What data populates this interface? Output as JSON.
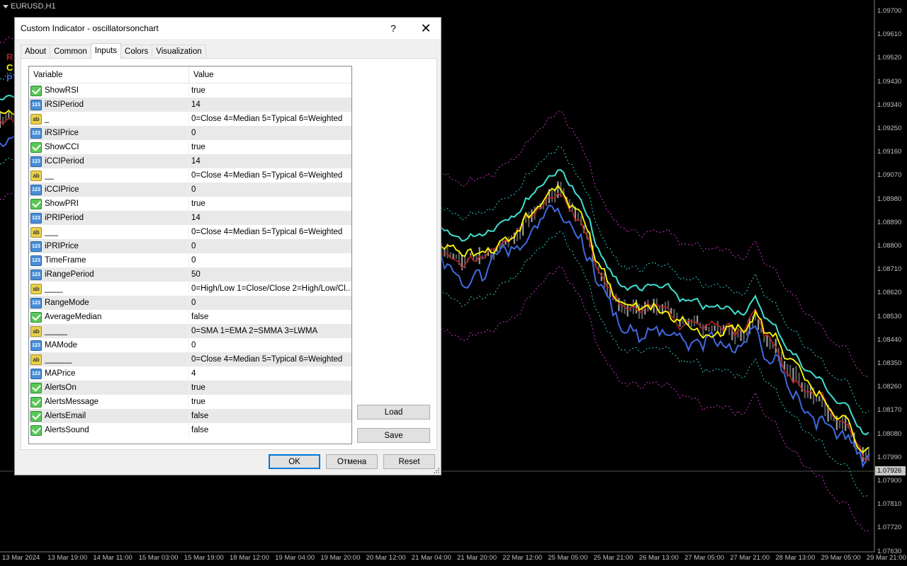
{
  "chart": {
    "symbol": "EURUSD,H1",
    "indicator_letters": [
      {
        "text": "R",
        "color": "#b22222"
      },
      {
        "text": "C",
        "color": "#ffff00"
      },
      {
        "text": "P",
        "color": "#4169e1"
      }
    ],
    "price_axis": [
      "1.09700",
      "1.09610",
      "1.09520",
      "1.09430",
      "1.09340",
      "1.09250",
      "1.09160",
      "1.09070",
      "1.08980",
      "1.08890",
      "1.08800",
      "1.08710",
      "1.08620",
      "1.08530",
      "1.08440",
      "1.08350",
      "1.08260",
      "1.08170",
      "1.08080",
      "1.07990",
      "1.07900",
      "1.07810",
      "1.07720",
      "1.07630"
    ],
    "current_price": "1.07926",
    "time_axis": [
      "13 Mar 2024",
      "13 Mar 19:00",
      "14 Mar 11:00",
      "15 Mar 03:00",
      "15 Mar 19:00",
      "18 Mar 12:00",
      "19 Mar 04:00",
      "19 Mar 20:00",
      "20 Mar 12:00",
      "21 Mar 04:00",
      "21 Mar 20:00",
      "22 Mar 12:00",
      "25 Mar 05:00",
      "25 Mar 21:00",
      "26 Mar 13:00",
      "27 Mar 05:00",
      "27 Mar 21:00",
      "28 Mar 13:00",
      "29 Mar 05:00",
      "29 Mar 21:00"
    ]
  },
  "dialog": {
    "title": "Custom Indicator - oscillatorsonchart",
    "help_glyph": "?",
    "close_glyph": "✕",
    "tabs": [
      "About",
      "Common",
      "Inputs",
      "Colors",
      "Visualization"
    ],
    "active_tab": "Inputs",
    "columns": {
      "variable": "Variable",
      "value": "Value"
    },
    "rows": [
      {
        "type": "bool",
        "variable": "ShowRSI",
        "value": "true"
      },
      {
        "type": "int",
        "variable": "iRSIPeriod",
        "value": "14"
      },
      {
        "type": "str",
        "variable": "_",
        "value": "0=Close 4=Median 5=Typical 6=Weighted"
      },
      {
        "type": "int",
        "variable": "iRSIPrice",
        "value": "0"
      },
      {
        "type": "bool",
        "variable": "ShowCCI",
        "value": "true"
      },
      {
        "type": "int",
        "variable": "iCCIPeriod",
        "value": "14"
      },
      {
        "type": "str",
        "variable": "__",
        "value": "0=Close 4=Median 5=Typical 6=Weighted"
      },
      {
        "type": "int",
        "variable": "iCCIPrice",
        "value": "0"
      },
      {
        "type": "bool",
        "variable": "ShowPRI",
        "value": "true"
      },
      {
        "type": "int",
        "variable": "iPRIPeriod",
        "value": "14"
      },
      {
        "type": "str",
        "variable": "___",
        "value": "0=Close 4=Median 5=Typical 6=Weighted"
      },
      {
        "type": "int",
        "variable": "iPRIPrice",
        "value": "0"
      },
      {
        "type": "int",
        "variable": "TimeFrame",
        "value": "0"
      },
      {
        "type": "int",
        "variable": "iRangePeriod",
        "value": "50"
      },
      {
        "type": "str",
        "variable": "____",
        "value": "0=High/Low 1=Close/Close 2=High/Low/Cl..."
      },
      {
        "type": "int",
        "variable": "RangeMode",
        "value": "0"
      },
      {
        "type": "bool",
        "variable": "AverageMedian",
        "value": "false"
      },
      {
        "type": "str",
        "variable": "_____",
        "value": "0=SMA 1=EMA 2=SMMA 3=LWMA"
      },
      {
        "type": "int",
        "variable": "MAMode",
        "value": "0"
      },
      {
        "type": "str",
        "variable": "______",
        "value": "0=Close 4=Median 5=Typical 6=Weighted"
      },
      {
        "type": "int",
        "variable": "MAPrice",
        "value": "4"
      },
      {
        "type": "bool",
        "variable": "AlertsOn",
        "value": "true"
      },
      {
        "type": "bool",
        "variable": "AlertsMessage",
        "value": "true"
      },
      {
        "type": "bool",
        "variable": "AlertsEmail",
        "value": "false"
      },
      {
        "type": "bool",
        "variable": "AlertsSound",
        "value": "false"
      }
    ],
    "buttons": {
      "load": "Load",
      "save": "Save",
      "ok": "OK",
      "cancel": "Отмена",
      "reset": "Reset"
    }
  }
}
